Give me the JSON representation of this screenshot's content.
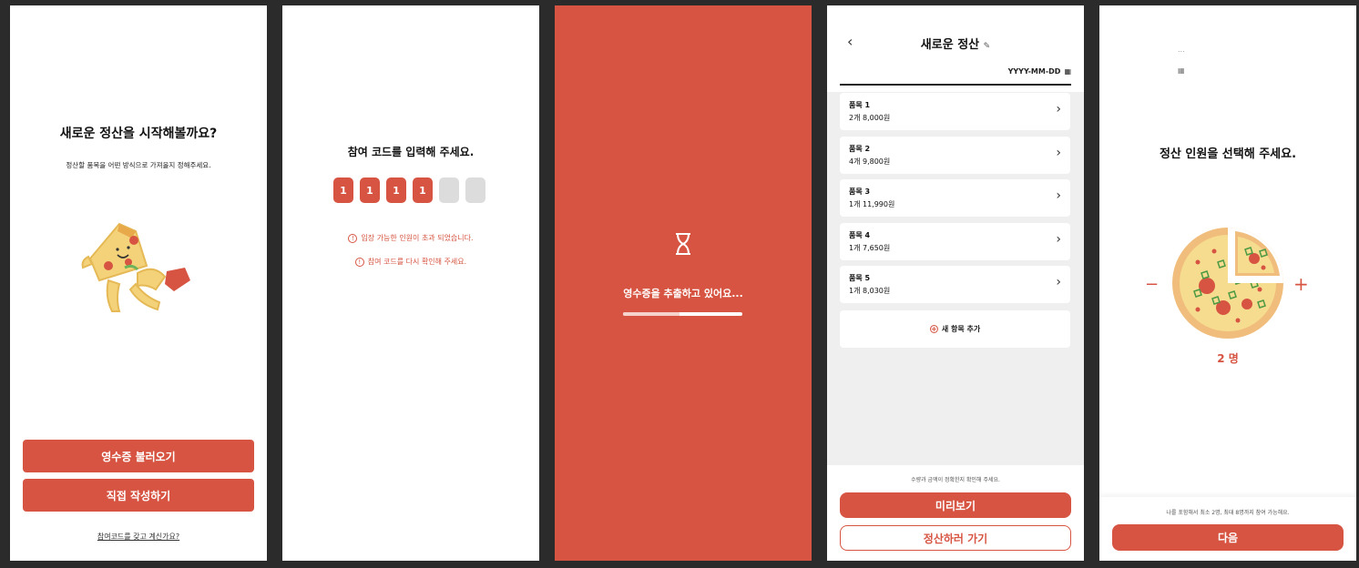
{
  "screen1": {
    "title": "새로운 정산을 시작해볼까요?",
    "subtitle": "정산할 품목을 어떤 방식으로 가져올지 정해주세요.",
    "btn_receipt": "영수증 불러오기",
    "btn_manual": "직접 작성하기",
    "code_link": "참여코드를 갖고 계신가요?"
  },
  "screen2": {
    "title": "참여 코드를 입력해 주세요.",
    "digits": [
      "1",
      "1",
      "1",
      "1",
      "",
      ""
    ],
    "error1": "입장 가능한 인원이 초과 되었습니다.",
    "error2": "참여 코드를 다시 확인해 주세요."
  },
  "screen3": {
    "message": "영수증을 추출하고 있어요...",
    "progress": 0.47
  },
  "screen4": {
    "title": "새로운 정산",
    "date_placeholder": "YYYY-MM-DD",
    "items": [
      {
        "name": "품목 1",
        "detail": "2개 8,000원"
      },
      {
        "name": "품목 2",
        "detail": "4개 9,800원"
      },
      {
        "name": "품목 3",
        "detail": "1개 11,990원"
      },
      {
        "name": "품목 4",
        "detail": "1개 7,650원"
      },
      {
        "name": "품목 5",
        "detail": "1개 8,030원"
      }
    ],
    "add_item": "새 항목 추가",
    "note": "수량과 금액이 정확한지 확인해 주세요.",
    "btn_preview": "미리보기",
    "btn_settle": "정산하러 가기"
  },
  "screen5": {
    "dots": "...",
    "title": "정산 인원을 선택해 주세요.",
    "count": "2 명",
    "minus": "−",
    "plus": "+",
    "note": "나를 포함해서 최소 2명, 최대 8명까지 참여 가능해요.",
    "btn_next": "다음"
  },
  "colors": {
    "accent": "#d65441",
    "background": "#2b2b2b"
  }
}
